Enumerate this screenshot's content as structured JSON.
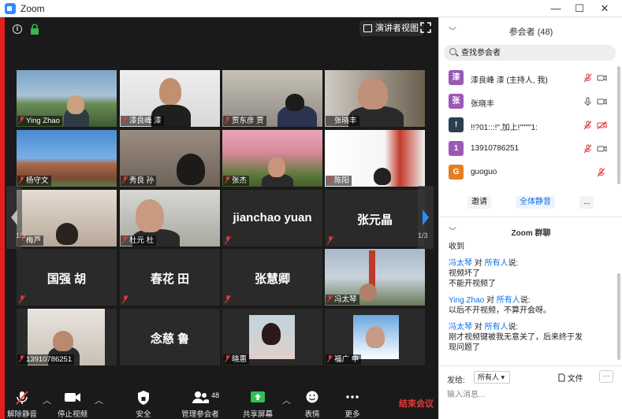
{
  "window": {
    "title": "Zoom",
    "minimize": "—",
    "maximize": "☐",
    "close": "✕"
  },
  "video": {
    "speaker_view_label": "演讲者视图",
    "page_indicator_left": "1/3",
    "page_indicator_right": "1/3",
    "tiles": [
      {
        "name": "Ying Zhao"
      },
      {
        "name": "漆良峰 漆"
      },
      {
        "name": "贾东彦 贾"
      },
      {
        "name": "张晓丰"
      },
      {
        "name": "杨守文"
      },
      {
        "name": "秀良 孙"
      },
      {
        "name": "张杰"
      },
      {
        "name": "陈阳"
      },
      {
        "name": "梅芦"
      },
      {
        "name": "杜元 杜"
      },
      {
        "name": "jianchao yuan",
        "big": true
      },
      {
        "name": "张元晶",
        "big": true
      },
      {
        "name": "国强 胡",
        "big": true
      },
      {
        "name": "春花 田",
        "big": true
      },
      {
        "name": "张慧卿",
        "big": true
      },
      {
        "name": "冯太琴"
      },
      {
        "name": "13910786251"
      },
      {
        "name": "念慈 鲁",
        "big": true
      },
      {
        "name": "晓惠"
      },
      {
        "name": "福广 申"
      }
    ]
  },
  "toolbar": {
    "unmute": "解除静音",
    "stop_video": "停止视频",
    "security": "安全",
    "participants": "管理参会者",
    "participants_count": "48",
    "share": "共享屏幕",
    "reactions": "表情",
    "more": "更多",
    "end": "结束会议"
  },
  "panel": {
    "title": "参会者 (48)",
    "search_placeholder": "查找参会者",
    "participants": [
      {
        "avatar": "漆",
        "color": "#9b59b6",
        "name": "漆良峰 漆 (主持人, 我)"
      },
      {
        "avatar": "张",
        "color": "#9b59b6",
        "name": "张晓丰"
      },
      {
        "avatar": "!",
        "color": "#2c3e50",
        "name": "!!?01:::!\",加上!\"\"\"\"1:"
      },
      {
        "avatar": "1",
        "color": "#9b59b6",
        "name": "13910786251"
      },
      {
        "avatar": "G",
        "color": "#e67e22",
        "name": "guoguo"
      }
    ],
    "invite": "邀请",
    "mute_all": "全体静音",
    "more": "...",
    "chat_title": "Zoom 群聊",
    "chat_partial": "收到",
    "messages": [
      {
        "sender": "冯太琴",
        "to_word": "对",
        "to": "所有人",
        "says": "说:",
        "lines": [
          "视频坏了",
          "不能开视频了"
        ]
      },
      {
        "sender": "Ying Zhao",
        "to_word": "对",
        "to": "所有人",
        "says": "说:",
        "lines": [
          "以后不开视频，不算开会呀。"
        ]
      },
      {
        "sender": "冯太琴",
        "to_word": "对",
        "to": "所有人",
        "says": "说:",
        "lines": [
          "刚才视频键被我无意关了，后来终于发",
          "现问题了"
        ]
      }
    ],
    "send_to_label": "发给:",
    "send_to_value": "所有人",
    "file_label": "文件",
    "more_label": "···",
    "input_placeholder": "输入消息..."
  }
}
